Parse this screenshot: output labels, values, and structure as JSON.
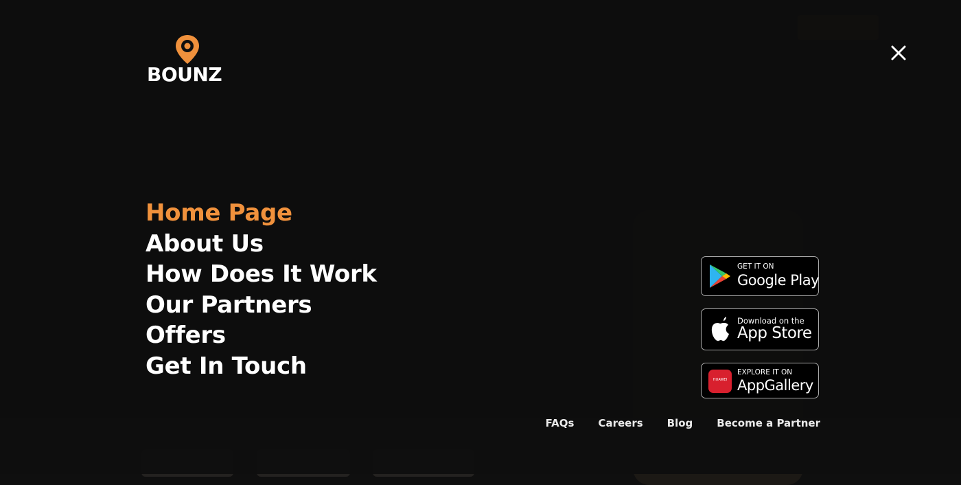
{
  "brand": {
    "name": "BOUNZ",
    "accent": "#f0913c"
  },
  "close": {
    "icon": "close-icon"
  },
  "nav": {
    "items": [
      {
        "label": "Home Page",
        "active": true
      },
      {
        "label": "About Us",
        "active": false
      },
      {
        "label": "How Does It Work",
        "active": false
      },
      {
        "label": "Our Partners",
        "active": false
      },
      {
        "label": "Offers",
        "active": false
      },
      {
        "label": "Get In Touch",
        "active": false
      }
    ]
  },
  "badges": {
    "google": {
      "small": "GET IT ON",
      "big": "Google Play",
      "icon": "google-play-icon"
    },
    "apple": {
      "small": "Download on the",
      "big": "App Store",
      "icon": "apple-icon"
    },
    "huawei": {
      "small": "EXPLORE IT ON",
      "big": "AppGallery",
      "icon": "huawei-appgallery-icon",
      "icon_text": "HUAWEI"
    }
  },
  "footer": {
    "links": [
      "FAQs",
      "Careers",
      "Blog",
      "Become a Partner"
    ]
  }
}
